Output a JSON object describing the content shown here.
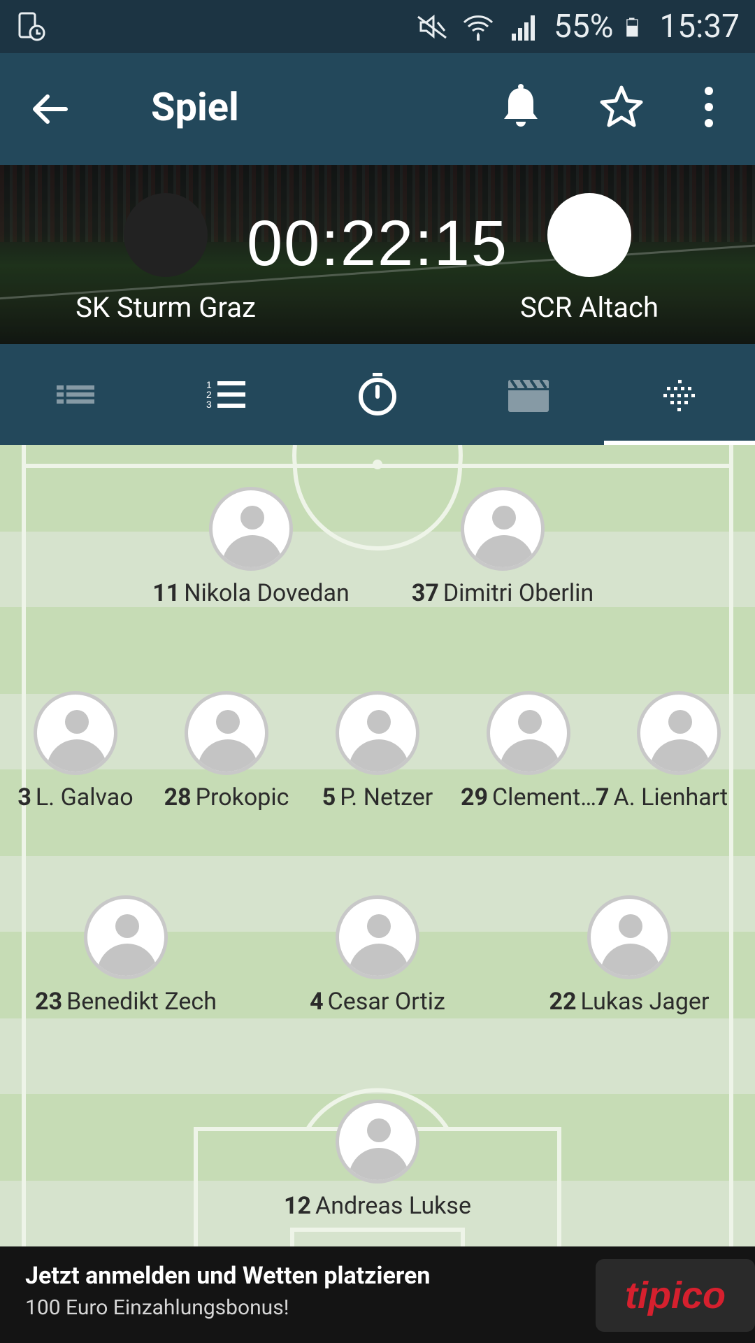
{
  "statusbar": {
    "battery": "55%",
    "time": "15:37"
  },
  "toolbar": {
    "title": "Spiel"
  },
  "match": {
    "timer": "00:22:15",
    "home_team": "SK Sturm Graz",
    "away_team": "SCR Altach"
  },
  "tabs": [
    {
      "icon": "list-lines-icon",
      "active": false
    },
    {
      "icon": "numbered-list-icon",
      "active": false
    },
    {
      "icon": "stopwatch-icon",
      "active": false
    },
    {
      "icon": "video-clapper-icon",
      "active": false
    },
    {
      "icon": "lineup-dots-icon",
      "active": true
    }
  ],
  "lineup": {
    "forwards": [
      {
        "number": "11",
        "name": "Nikola Dovedan"
      },
      {
        "number": "37",
        "name": "Dimitri Oberlin"
      }
    ],
    "midfield": [
      {
        "number": "3",
        "name": "L. Galvao"
      },
      {
        "number": "28",
        "name": "Prokopic"
      },
      {
        "number": "5",
        "name": "P. Netzer"
      },
      {
        "number": "29",
        "name": "Clement…"
      },
      {
        "number": "7",
        "name": "A. Lienhart"
      }
    ],
    "defense": [
      {
        "number": "23",
        "name": "Benedikt Zech"
      },
      {
        "number": "4",
        "name": "Cesar Ortiz"
      },
      {
        "number": "22",
        "name": "Lukas Jager"
      }
    ],
    "goalkeeper": [
      {
        "number": "12",
        "name": "Andreas Lukse"
      }
    ]
  },
  "ad": {
    "headline": "Jetzt anmelden und Wetten platzieren",
    "subline": "100 Euro Einzahlungsbonus!",
    "brand": "tipico"
  },
  "colors": {
    "toolbar": "#23485b",
    "statusbar": "#1c3443",
    "pitch_light": "#d6e3cd",
    "pitch_dark": "#c6dcb5",
    "brand_red": "#d6202e"
  }
}
